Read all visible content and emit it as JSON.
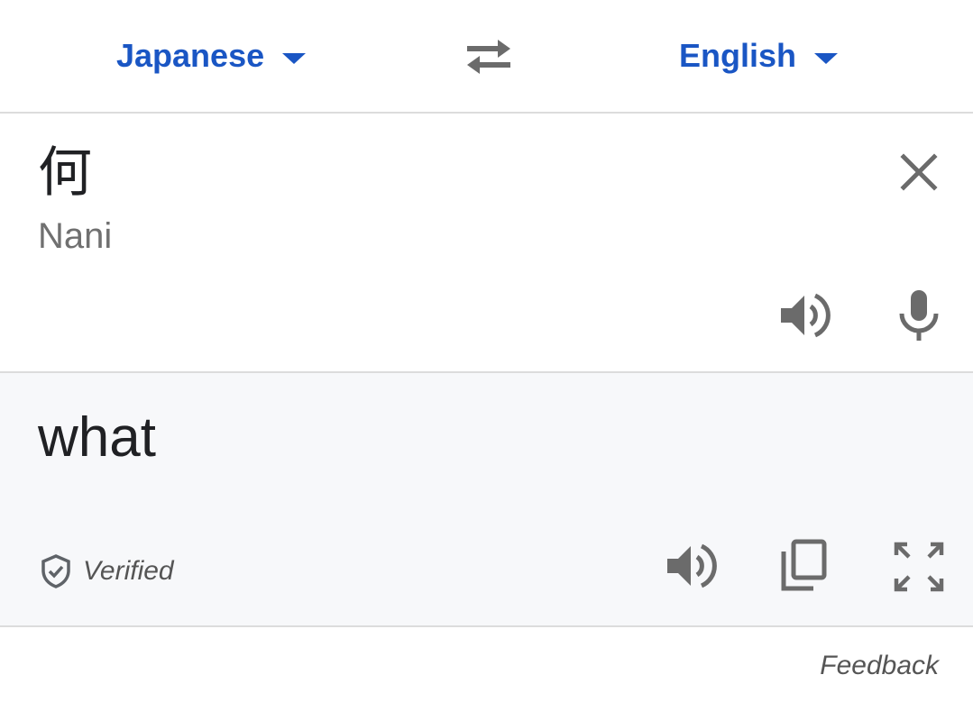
{
  "language_bar": {
    "source_language": "Japanese",
    "target_language": "English",
    "swap_icon": "swap-arrows-icon",
    "caret_icon": "caret-down-icon",
    "accent_color": "#1a56c4"
  },
  "source": {
    "text": "何",
    "transliteration": "Nani",
    "icons": [
      "close-icon",
      "speaker-icon",
      "microphone-icon"
    ]
  },
  "translation": {
    "text": "what",
    "verified_label": "Verified",
    "background_color": "#f7f8fa",
    "icons": [
      "shield-check-icon",
      "speaker-icon",
      "copy-icon",
      "fullscreen-icon"
    ]
  },
  "footer": {
    "feedback_label": "Feedback"
  }
}
